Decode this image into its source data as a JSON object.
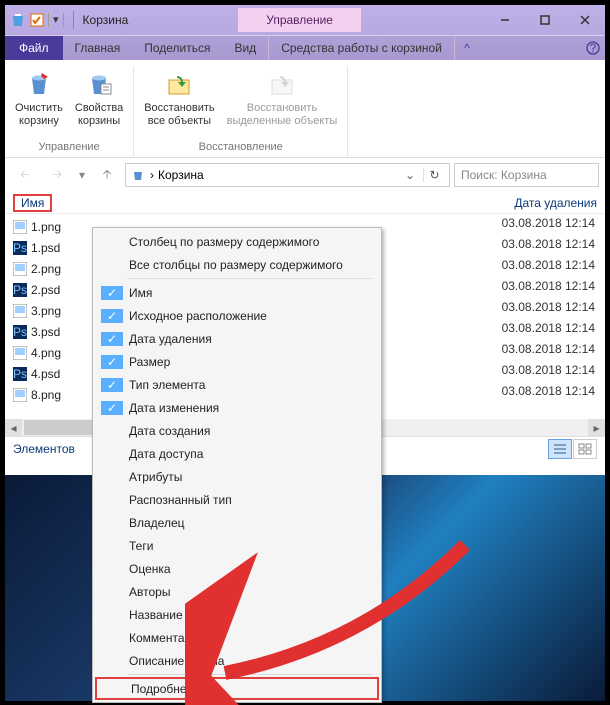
{
  "title": "Корзина",
  "manage_tab": "Управление",
  "tabs": {
    "file": "Файл",
    "home": "Главная",
    "share": "Поделиться",
    "view": "Вид",
    "recycle_tools": "Средства работы с корзиной"
  },
  "ribbon": {
    "group_manage": "Управление",
    "group_restore": "Восстановление",
    "empty_bin": "Очистить\nкорзину",
    "bin_props": "Свойства\nкорзины",
    "restore_all": "Восстановить\nвсе объекты",
    "restore_selected": "Восстановить\nвыделенные объекты"
  },
  "addr": {
    "crumb_arrow": "›",
    "location": "Корзина"
  },
  "search_placeholder": "Поиск: Корзина",
  "columns": {
    "name": "Имя",
    "date_deleted": "Дата удаления"
  },
  "files": [
    {
      "name": "1.png",
      "type": "png",
      "date": "03.08.2018 12:14"
    },
    {
      "name": "1.psd",
      "type": "psd",
      "date": "03.08.2018 12:14"
    },
    {
      "name": "2.png",
      "type": "png",
      "date": "03.08.2018 12:14"
    },
    {
      "name": "2.psd",
      "type": "psd",
      "date": "03.08.2018 12:14"
    },
    {
      "name": "3.png",
      "type": "png",
      "date": "03.08.2018 12:14"
    },
    {
      "name": "3.psd",
      "type": "psd",
      "date": "03.08.2018 12:14"
    },
    {
      "name": "4.png",
      "type": "png",
      "date": "03.08.2018 12:14"
    },
    {
      "name": "4.psd",
      "type": "psd",
      "date": "03.08.2018 12:14"
    },
    {
      "name": "8.png",
      "type": "png",
      "date": "03.08.2018 12:14"
    }
  ],
  "status": "Элементов",
  "menu": {
    "size_column": "Столбец по размеру содержимого",
    "size_all": "Все столбцы по размеру содержимого",
    "items": [
      {
        "label": "Имя",
        "checked": true
      },
      {
        "label": "Исходное расположение",
        "checked": true
      },
      {
        "label": "Дата удаления",
        "checked": true
      },
      {
        "label": "Размер",
        "checked": true
      },
      {
        "label": "Тип элемента",
        "checked": true
      },
      {
        "label": "Дата изменения",
        "checked": true
      },
      {
        "label": "Дата создания",
        "checked": false
      },
      {
        "label": "Дата доступа",
        "checked": false
      },
      {
        "label": "Атрибуты",
        "checked": false
      },
      {
        "label": "Распознанный тип",
        "checked": false
      },
      {
        "label": "Владелец",
        "checked": false
      },
      {
        "label": "Теги",
        "checked": false
      },
      {
        "label": "Оценка",
        "checked": false
      },
      {
        "label": "Авторы",
        "checked": false
      },
      {
        "label": "Название",
        "checked": false
      },
      {
        "label": "Комментарии",
        "checked": false
      },
      {
        "label": "Описание файла",
        "checked": false
      }
    ],
    "more": "Подробнее..."
  }
}
